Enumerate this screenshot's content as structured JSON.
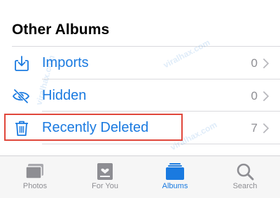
{
  "section_title": "Other Albums",
  "albums": [
    {
      "label": "Imports",
      "count": "0",
      "icon": "import-icon"
    },
    {
      "label": "Hidden",
      "count": "0",
      "icon": "eye-slash-icon"
    },
    {
      "label": "Recently Deleted",
      "count": "7",
      "icon": "trash-icon"
    }
  ],
  "watermark": "viralhax.com",
  "tabs": [
    {
      "label": "Photos",
      "icon": "photos-icon"
    },
    {
      "label": "For You",
      "icon": "for-you-icon"
    },
    {
      "label": "Albums",
      "icon": "albums-icon",
      "active": true
    },
    {
      "label": "Search",
      "icon": "search-icon"
    }
  ],
  "colors": {
    "accent": "#1a7ae0",
    "secondary": "#8e8e93",
    "highlight": "#e0463a"
  }
}
